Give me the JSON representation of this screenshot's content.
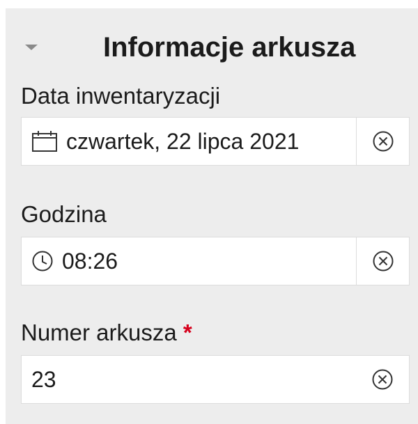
{
  "panel": {
    "title": "Informacje arkusza",
    "collapse_icon": "chevron-down-icon"
  },
  "fields": {
    "date": {
      "label": "Data inwentaryzacji",
      "value": "czwartek, 22 lipca 2021",
      "icon": "calendar-icon",
      "clear_icon": "clear-circle-icon"
    },
    "time": {
      "label": "Godzina",
      "value": "08:26",
      "icon": "clock-icon",
      "clear_icon": "clear-circle-icon"
    },
    "sheet_number": {
      "label": "Numer arkusza",
      "required_marker": "*",
      "value": "23",
      "clear_icon": "clear-circle-icon"
    }
  },
  "colors": {
    "panel_background": "#ededed",
    "field_background": "#ffffff",
    "field_border": "#dcdcdc",
    "text": "#1b1b1b",
    "required": "#d6001c",
    "icon": "#333333"
  }
}
